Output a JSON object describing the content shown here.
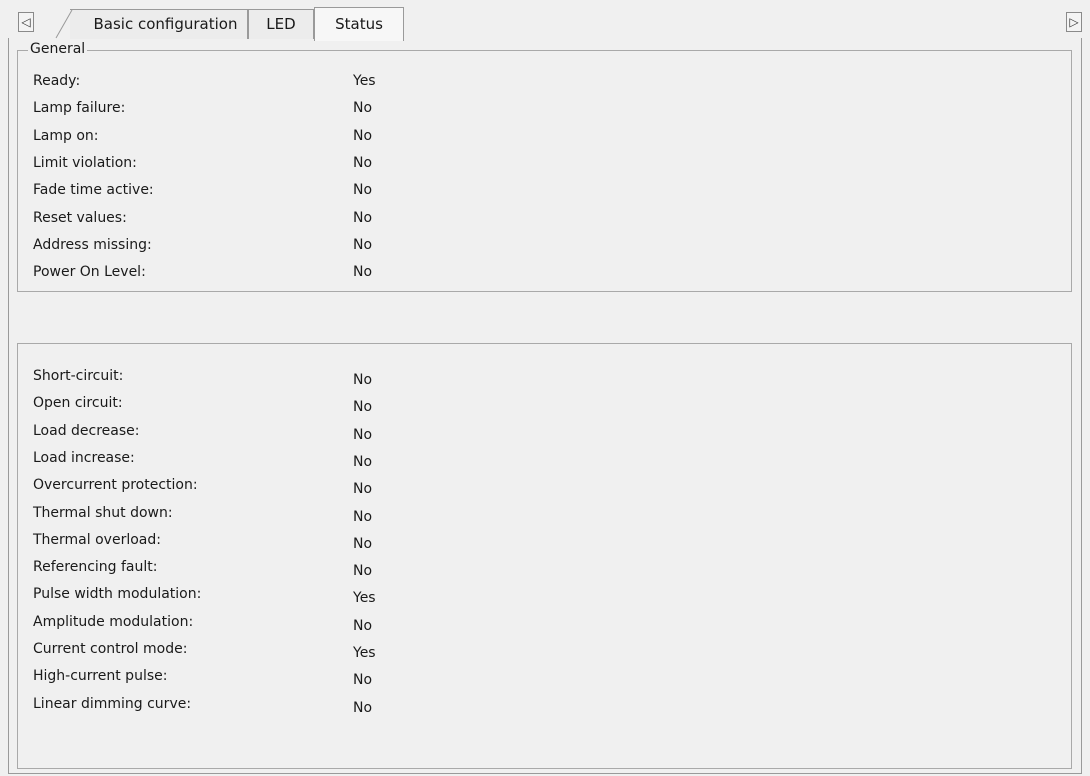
{
  "tabs": {
    "prev_icon": "◁",
    "next_icon": "▷",
    "items": [
      {
        "label": "Basic configuration"
      },
      {
        "label": "LED"
      },
      {
        "label": "Status"
      }
    ]
  },
  "general": {
    "title": "General",
    "rows": [
      {
        "label": "Ready:",
        "value": "Yes"
      },
      {
        "label": "Lamp failure:",
        "value": "No"
      },
      {
        "label": "Lamp on:",
        "value": "No"
      },
      {
        "label": "Limit violation:",
        "value": "No"
      },
      {
        "label": "Fade time active:",
        "value": "No"
      },
      {
        "label": "Reset values:",
        "value": "No"
      },
      {
        "label": "Address missing:",
        "value": "No"
      },
      {
        "label": "Power On Level:",
        "value": "No"
      }
    ]
  },
  "faults": {
    "rows": [
      {
        "label": "Short-circuit:",
        "value": "No"
      },
      {
        "label": "Open circuit:",
        "value": "No"
      },
      {
        "label": "Load decrease:",
        "value": "No"
      },
      {
        "label": "Load increase:",
        "value": "No"
      },
      {
        "label": "Overcurrent protection:",
        "value": "No"
      },
      {
        "label": "Thermal shut down:",
        "value": "No"
      },
      {
        "label": "Thermal overload:",
        "value": "No"
      },
      {
        "label": "Referencing fault:",
        "value": "No"
      },
      {
        "label": "Pulse width modulation:",
        "value": "Yes"
      },
      {
        "label": "Amplitude modulation:",
        "value": "No"
      },
      {
        "label": "Current control mode:",
        "value": "Yes"
      },
      {
        "label": "High-current pulse:",
        "value": "No"
      },
      {
        "label": "Linear dimming curve:",
        "value": "No"
      }
    ]
  }
}
